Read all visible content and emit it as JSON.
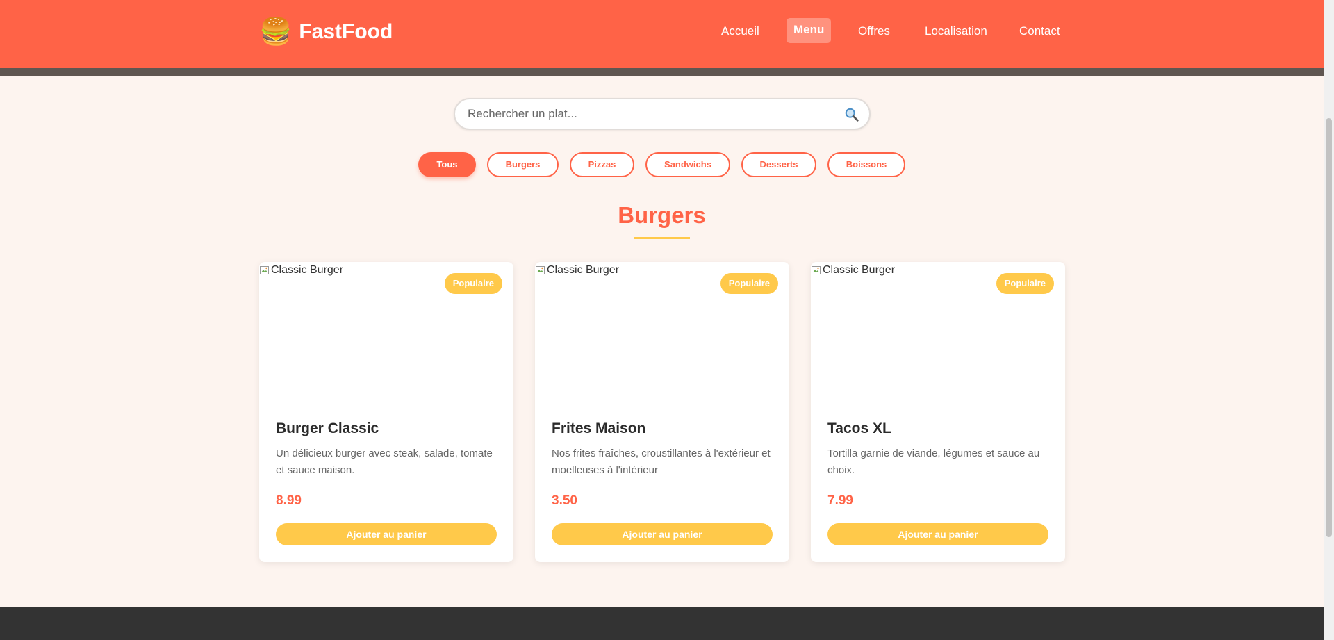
{
  "header": {
    "logo_icon": "🍔",
    "logo_text": "FastFood",
    "nav": [
      {
        "label": "Accueil",
        "active": false
      },
      {
        "label": "Menu",
        "active": true
      },
      {
        "label": "Offres",
        "active": false
      },
      {
        "label": "Localisation",
        "active": false
      },
      {
        "label": "Contact",
        "active": false
      }
    ]
  },
  "search": {
    "placeholder": "Rechercher un plat...",
    "value": "",
    "icon": "search-icon"
  },
  "filters": [
    {
      "label": "Tous",
      "active": true
    },
    {
      "label": "Burgers",
      "active": false
    },
    {
      "label": "Pizzas",
      "active": false
    },
    {
      "label": "Sandwichs",
      "active": false
    },
    {
      "label": "Desserts",
      "active": false
    },
    {
      "label": "Boissons",
      "active": false
    }
  ],
  "section": {
    "title": "Burgers"
  },
  "products": [
    {
      "image_alt": "Classic Burger",
      "badge": "Populaire",
      "name": "Burger Classic",
      "description": "Un délicieux burger avec steak, salade, tomate et sauce maison.",
      "price": "8.99",
      "button": "Ajouter au panier"
    },
    {
      "image_alt": "Classic Burger",
      "badge": "Populaire",
      "name": "Frites Maison",
      "description": "Nos frites fraîches, croustillantes à l'extérieur et moelleuses à l'intérieur",
      "price": "3.50",
      "button": "Ajouter au panier"
    },
    {
      "image_alt": "Classic Burger",
      "badge": "Populaire",
      "name": "Tacos XL",
      "description": "Tortilla garnie de viande, légumes et sauce au choix.",
      "price": "7.99",
      "button": "Ajouter au panier"
    }
  ],
  "colors": {
    "primary": "#ff6347",
    "accent": "#ffc94a",
    "background": "#fdf4ef",
    "footer": "#333333"
  }
}
